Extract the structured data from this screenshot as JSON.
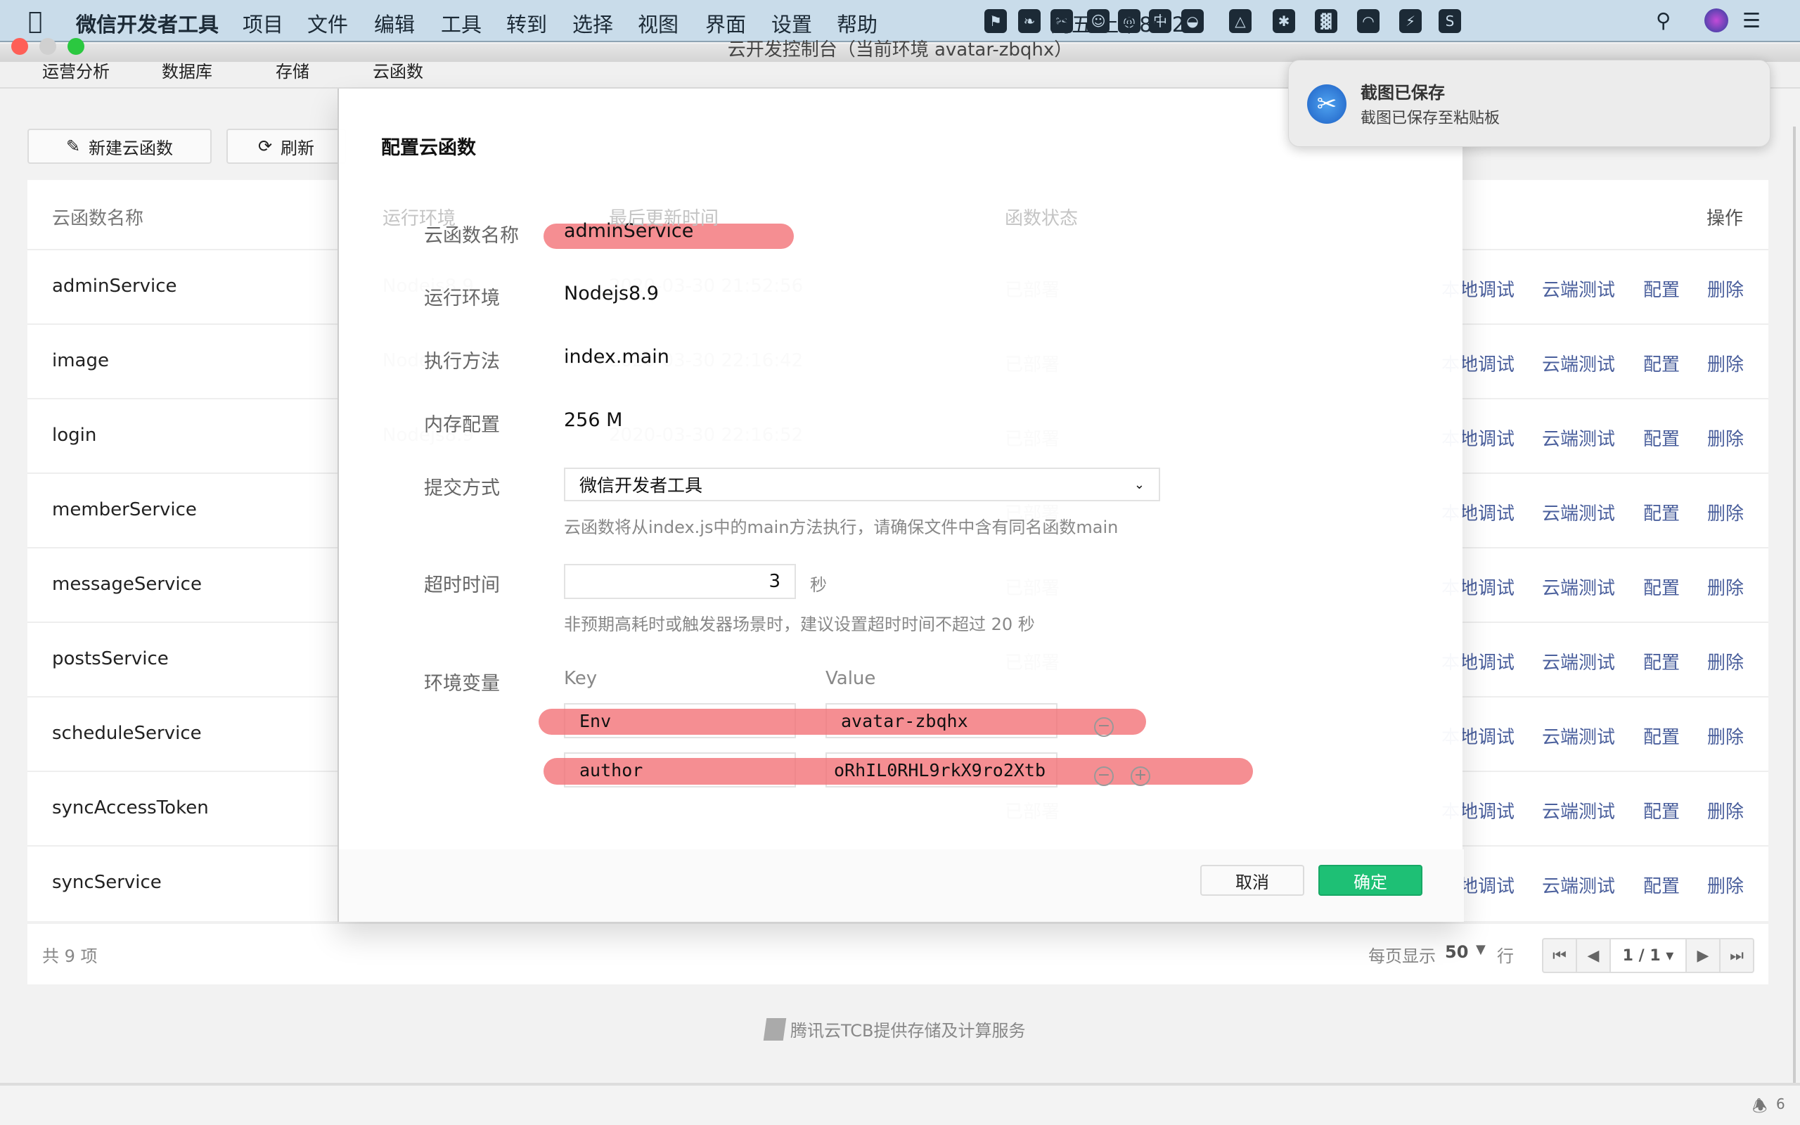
{
  "menubar": {
    "app": "微信开发者工具",
    "items": [
      "项目",
      "文件",
      "编辑",
      "工具",
      "转到",
      "选择",
      "视图",
      "界面",
      "设置",
      "帮助"
    ],
    "tray_icons": [
      "bookmark-icon",
      "evernote-icon",
      "scissors-icon",
      "face-icon",
      "mic-icon",
      "input-zh-icon",
      "wechat-icon",
      "airplay-icon",
      "bluetooth-icon",
      "battery-icon",
      "wifi-icon",
      "charging-icon",
      "s-app-icon"
    ],
    "tray_zh": "中",
    "clock": "周五 上午8:22"
  },
  "window": {
    "title": "云开发控制台（当前环境 avatar-zbqhx）"
  },
  "tabs": [
    "运营分析",
    "数据库",
    "存储",
    "云函数"
  ],
  "toolbar": {
    "new_label": "新建云函数",
    "refresh_label": "刷新"
  },
  "table": {
    "headers": {
      "name": "云函数名称",
      "runtime": "运行环境",
      "updated": "最后更新时间",
      "status": "函数状态",
      "actions": "操作"
    },
    "actions": [
      "本地调试",
      "云端测试",
      "配置",
      "删除"
    ],
    "rows": [
      {
        "name": "adminService",
        "runtime": "Nodejs8.9",
        "updated": "2020-03-30 21:52:56",
        "status": "已部署"
      },
      {
        "name": "image",
        "runtime": "Nodejs8.9",
        "updated": "2020-03-30 22:16:42",
        "status": "已部署"
      },
      {
        "name": "login",
        "runtime": "Nodejs8.9",
        "updated": "2020-03-30 22:16:52",
        "status": "已部署"
      },
      {
        "name": "memberService",
        "status": "已部署"
      },
      {
        "name": "messageService",
        "status": "已部署"
      },
      {
        "name": "postsService",
        "status": "已部署"
      },
      {
        "name": "scheduleService",
        "status": ""
      },
      {
        "name": "syncAccessToken",
        "status": "已部署"
      },
      {
        "name": "syncService",
        "status": ""
      }
    ],
    "total": "共 9 项",
    "per_page_label": "每页显示",
    "per_page": "50",
    "per_page_unit": "行",
    "page": "1 / 1"
  },
  "dialog": {
    "title": "配置云函数",
    "name_label": "云函数名称",
    "name": "adminService",
    "runtime_label": "运行环境",
    "runtime": "Nodejs8.9",
    "handler_label": "执行方法",
    "handler": "index.main",
    "memory_label": "内存配置",
    "memory": "256 M",
    "submit_label": "提交方式",
    "submit_value": "微信开发者工具",
    "submit_hint": "云函数将从index.js中的main方法执行，请确保文件中含有同名函数main",
    "timeout_label": "超时时间",
    "timeout": "3",
    "timeout_unit": "秒",
    "timeout_hint": "非预期高耗时或触发器场景时，建议设置超时时间不超过 20 秒",
    "env_label": "环境变量",
    "key_header": "Key",
    "value_header": "Value",
    "env": [
      {
        "key": "Env",
        "value": "avatar-zbqhx"
      },
      {
        "key": "author",
        "value": "oRhIL0RHL9rkX9ro2Xtb"
      }
    ],
    "cancel": "取消",
    "ok": "确定"
  },
  "notification": {
    "title": "截图已保存",
    "body": "截图已保存至粘贴板"
  },
  "footer": {
    "credit": "腾讯云TCB提供存储及计算服务",
    "notifications": "6"
  },
  "colors": {
    "accent_green": "#1ec075",
    "link": "#4a5f9c",
    "highlight": "#f26e73",
    "menubar": "#c9dcea"
  }
}
